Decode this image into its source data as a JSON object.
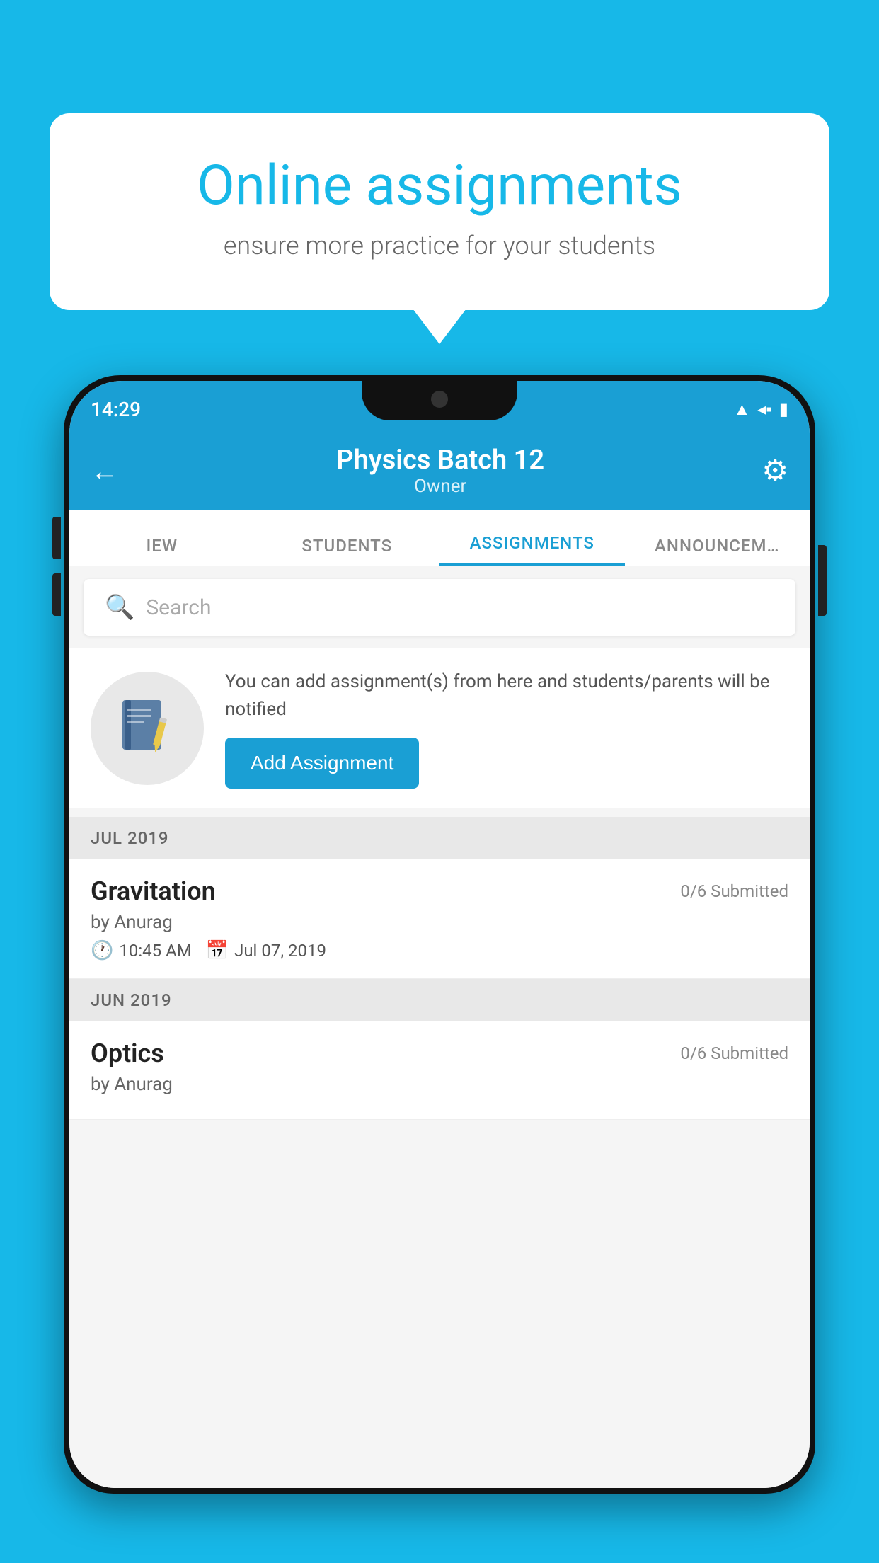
{
  "background_color": "#17b8e8",
  "speech_bubble": {
    "title": "Online assignments",
    "subtitle": "ensure more practice for your students"
  },
  "status_bar": {
    "time": "14:29",
    "icons": [
      "wifi",
      "signal",
      "battery"
    ]
  },
  "app_bar": {
    "title": "Physics Batch 12",
    "subtitle": "Owner",
    "back_label": "←",
    "gear_label": "⚙"
  },
  "tabs": [
    {
      "label": "IEW",
      "active": false
    },
    {
      "label": "STUDENTS",
      "active": false
    },
    {
      "label": "ASSIGNMENTS",
      "active": true
    },
    {
      "label": "ANNOUNCEM…",
      "active": false
    }
  ],
  "search": {
    "placeholder": "Search"
  },
  "promo": {
    "text": "You can add assignment(s) from here and students/parents will be notified",
    "button_label": "Add Assignment"
  },
  "sections": [
    {
      "header": "JUL 2019",
      "assignments": [
        {
          "name": "Gravitation",
          "submitted": "0/6 Submitted",
          "by": "by Anurag",
          "time": "10:45 AM",
          "date": "Jul 07, 2019"
        }
      ]
    },
    {
      "header": "JUN 2019",
      "assignments": [
        {
          "name": "Optics",
          "submitted": "0/6 Submitted",
          "by": "by Anurag",
          "time": "",
          "date": ""
        }
      ]
    }
  ]
}
